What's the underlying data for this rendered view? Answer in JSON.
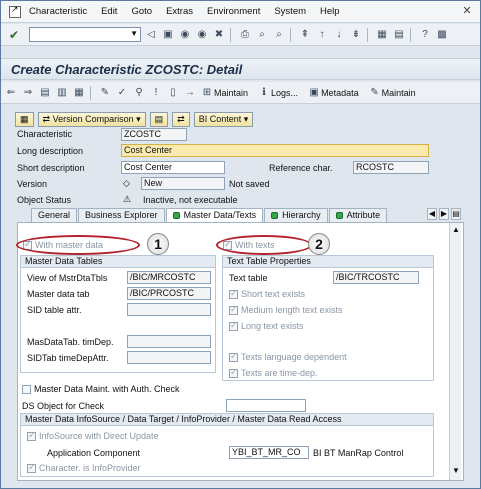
{
  "menu": {
    "items": [
      "Characteristic",
      "Edit",
      "Goto",
      "Extras",
      "Environment",
      "System",
      "Help"
    ]
  },
  "title": "Create Characteristic ZCOSTC: Detail",
  "app_toolbar": {
    "maintain": "Maintain",
    "logs": "Logs...",
    "metadata": "Metadata",
    "maintain2": "Maintain"
  },
  "sub_toolbar": {
    "version_comparison": "Version Comparison",
    "bi_content": "BI Content"
  },
  "form": {
    "characteristic_label": "Characteristic",
    "characteristic_value": "ZCOSTC",
    "long_desc_label": "Long description",
    "long_desc_value": "Cost Center",
    "short_desc_label": "Short description",
    "short_desc_value": "Cost Center",
    "ref_char_label": "Reference char.",
    "ref_char_value": "RCOSTC",
    "version_label": "Version",
    "version_value": "New",
    "version_status": "Not saved",
    "object_status_label": "Object Status",
    "object_status_value": "Inactive, not executable"
  },
  "tabs": [
    "General",
    "Business Explorer",
    "Master Data/Texts",
    "Hierarchy",
    "Attribute"
  ],
  "master": {
    "with_master_data": "With master data",
    "group_title": "Master Data Tables",
    "view_label": "View of MstrDtaTbls",
    "view_value": "/BIC/MRCOSTC",
    "tab_label": "Master data tab",
    "tab_value": "/BIC/PRCOSTC",
    "sid_label": "SID table attr.",
    "mastab_label": "MasDataTab. timDep.",
    "sidtab_label": "SIDTab timeDepAttr."
  },
  "texts": {
    "with_texts": "With texts",
    "group_title": "Text Table Properties",
    "table_label": "Text table",
    "table_value": "/BIC/TRCOSTC",
    "short_text": "Short text exists",
    "medium_text": "Medium length text exists",
    "long_text": "Long text exists",
    "lang_dep": "Texts language dependent",
    "time_dep": "Texts are time-dep."
  },
  "auth_check": "Master Data Maint. with Auth. Check",
  "ds_object": "DS Object for Check",
  "infosource": {
    "group_title": "Master Data InfoSource / Data Target / InfoProvider / Master Data Read Access",
    "direct_update": "InfoSource with Direct Update",
    "app_comp_label": "Application Component",
    "app_comp_value": "YBI_BT_MR_CO",
    "app_comp_desc": "BI BT ManRap Control",
    "is_infoprovider": "Character. is InfoProvider"
  },
  "markers": [
    "1",
    "2"
  ]
}
